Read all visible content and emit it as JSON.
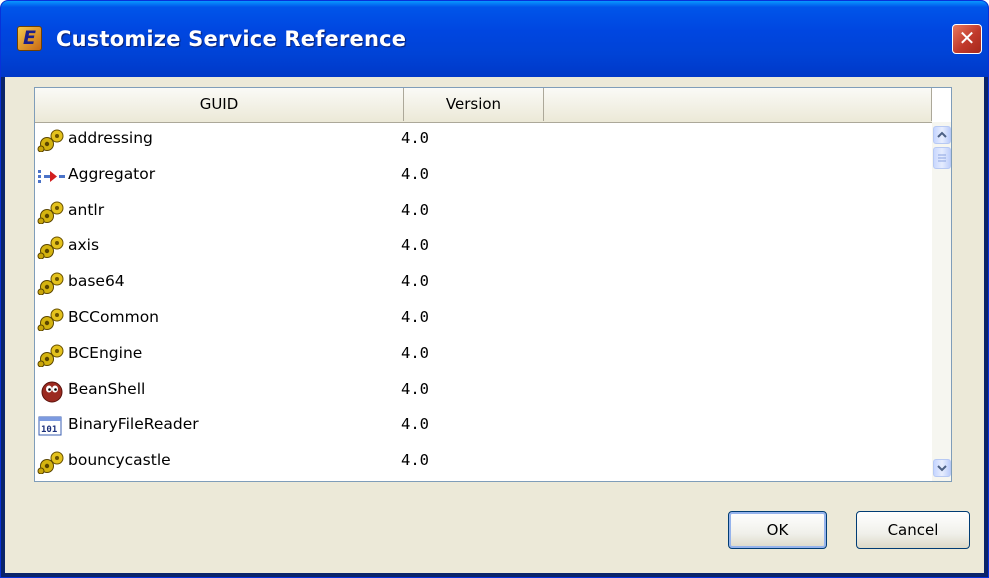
{
  "window": {
    "title": "Customize Service Reference",
    "close_glyph": "✕",
    "app_icon_letter": "E"
  },
  "table": {
    "columns": [
      "GUID",
      "Version",
      ""
    ],
    "rows": [
      {
        "name": "addressing",
        "version": "4.0",
        "icon": "gears-icon"
      },
      {
        "name": "Aggregator",
        "version": "4.0",
        "icon": "aggregator-arrow-icon"
      },
      {
        "name": "antlr",
        "version": "4.0",
        "icon": "gears-icon"
      },
      {
        "name": "axis",
        "version": "4.0",
        "icon": "gears-icon"
      },
      {
        "name": "base64",
        "version": "4.0",
        "icon": "gears-icon"
      },
      {
        "name": "BCCommon",
        "version": "4.0",
        "icon": "gears-icon"
      },
      {
        "name": "BCEngine",
        "version": "4.0",
        "icon": "gears-icon"
      },
      {
        "name": "BeanShell",
        "version": "4.0",
        "icon": "beanshell-bean-icon"
      },
      {
        "name": "BinaryFileReader",
        "version": "4.0",
        "icon": "binary-file-icon"
      },
      {
        "name": "bouncycastle",
        "version": "4.0",
        "icon": "gears-icon"
      }
    ]
  },
  "buttons": {
    "ok": "OK",
    "cancel": "Cancel"
  }
}
